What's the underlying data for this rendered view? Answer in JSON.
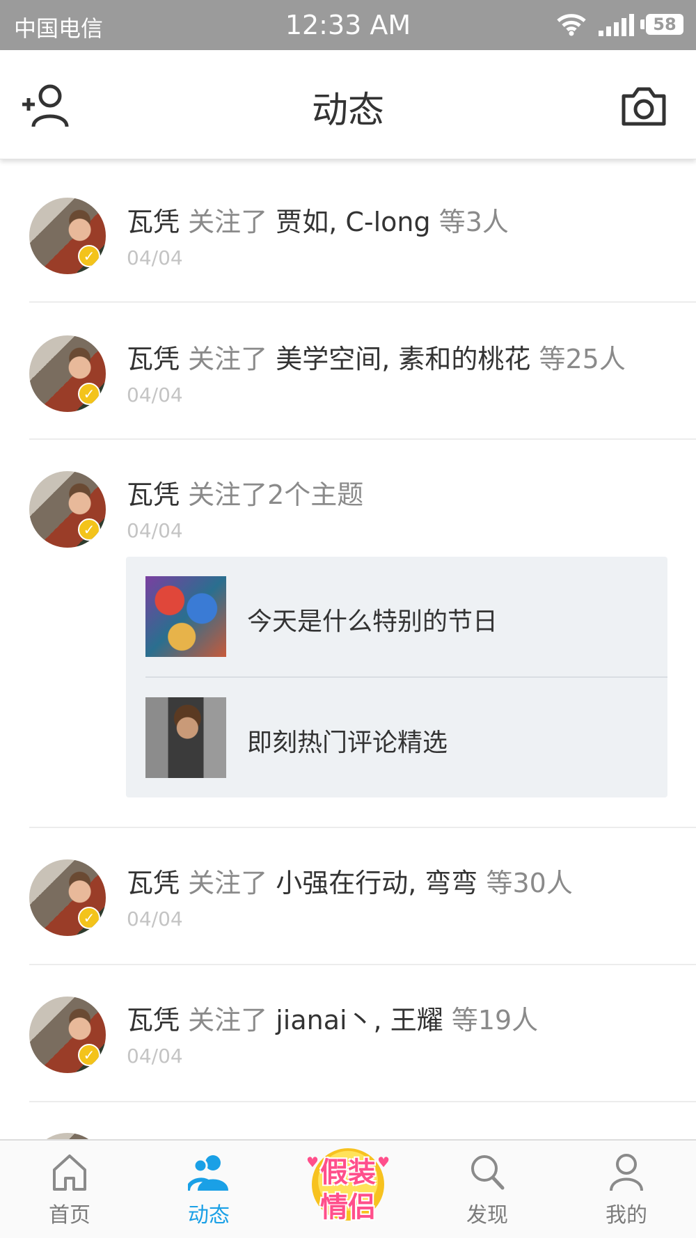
{
  "status_bar": {
    "carrier": "中国电信",
    "time": "12:33 AM",
    "battery": "58"
  },
  "header": {
    "title": "动态",
    "left_icon": "add-friend-icon",
    "right_icon": "camera-icon"
  },
  "feed": [
    {
      "name": "瓦凭",
      "verb": "关注了",
      "targets": "贾如, C-long",
      "count": "等3人",
      "date": "04/04"
    },
    {
      "name": "瓦凭",
      "verb": "关注了",
      "targets": "美学空间, 素和的桃花",
      "count": "等25人",
      "date": "04/04"
    },
    {
      "name": "瓦凭",
      "verb": "关注了2个主题",
      "date": "04/04",
      "topics": [
        {
          "label": "今天是什么特别的节日"
        },
        {
          "label": "即刻热门评论精选"
        }
      ]
    },
    {
      "name": "瓦凭",
      "verb": "关注了",
      "targets": "小强在行动, 弯弯",
      "count": "等30人",
      "date": "04/04"
    },
    {
      "name": "瓦凭",
      "verb": "关注了",
      "targets": "jianai丶, 王耀",
      "count": "等19人",
      "date": "04/04"
    }
  ],
  "tabbar": {
    "tabs": [
      {
        "label": "首页",
        "icon": "home-icon",
        "active": false
      },
      {
        "label": "动态",
        "icon": "people-icon",
        "active": true
      },
      {
        "label": "发现",
        "icon": "search-icon",
        "active": false
      },
      {
        "label": "我的",
        "icon": "profile-icon",
        "active": false
      }
    ],
    "promo": {
      "line1": "假装",
      "line2": "情侣"
    }
  },
  "colors": {
    "accent": "#1aa0e6",
    "status_bar": "#9b9b9b",
    "topic_box": "#eef1f4",
    "verified_badge": "#f3c31b"
  }
}
